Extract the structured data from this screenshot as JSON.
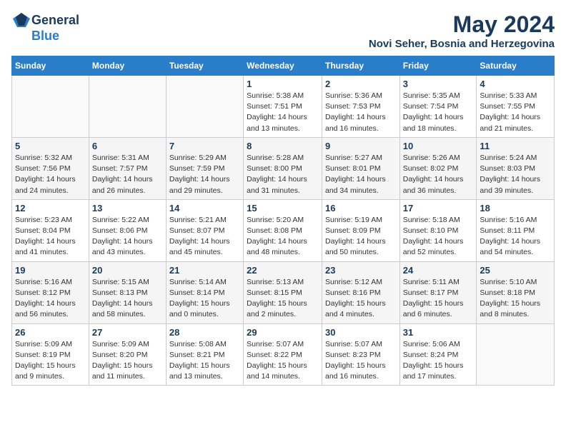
{
  "header": {
    "logo_general": "General",
    "logo_blue": "Blue",
    "month_title": "May 2024",
    "location": "Novi Seher, Bosnia and Herzegovina"
  },
  "weekdays": [
    "Sunday",
    "Monday",
    "Tuesday",
    "Wednesday",
    "Thursday",
    "Friday",
    "Saturday"
  ],
  "weeks": [
    [
      {
        "day": "",
        "info": ""
      },
      {
        "day": "",
        "info": ""
      },
      {
        "day": "",
        "info": ""
      },
      {
        "day": "1",
        "info": "Sunrise: 5:38 AM\nSunset: 7:51 PM\nDaylight: 14 hours\nand 13 minutes."
      },
      {
        "day": "2",
        "info": "Sunrise: 5:36 AM\nSunset: 7:53 PM\nDaylight: 14 hours\nand 16 minutes."
      },
      {
        "day": "3",
        "info": "Sunrise: 5:35 AM\nSunset: 7:54 PM\nDaylight: 14 hours\nand 18 minutes."
      },
      {
        "day": "4",
        "info": "Sunrise: 5:33 AM\nSunset: 7:55 PM\nDaylight: 14 hours\nand 21 minutes."
      }
    ],
    [
      {
        "day": "5",
        "info": "Sunrise: 5:32 AM\nSunset: 7:56 PM\nDaylight: 14 hours\nand 24 minutes."
      },
      {
        "day": "6",
        "info": "Sunrise: 5:31 AM\nSunset: 7:57 PM\nDaylight: 14 hours\nand 26 minutes."
      },
      {
        "day": "7",
        "info": "Sunrise: 5:29 AM\nSunset: 7:59 PM\nDaylight: 14 hours\nand 29 minutes."
      },
      {
        "day": "8",
        "info": "Sunrise: 5:28 AM\nSunset: 8:00 PM\nDaylight: 14 hours\nand 31 minutes."
      },
      {
        "day": "9",
        "info": "Sunrise: 5:27 AM\nSunset: 8:01 PM\nDaylight: 14 hours\nand 34 minutes."
      },
      {
        "day": "10",
        "info": "Sunrise: 5:26 AM\nSunset: 8:02 PM\nDaylight: 14 hours\nand 36 minutes."
      },
      {
        "day": "11",
        "info": "Sunrise: 5:24 AM\nSunset: 8:03 PM\nDaylight: 14 hours\nand 39 minutes."
      }
    ],
    [
      {
        "day": "12",
        "info": "Sunrise: 5:23 AM\nSunset: 8:04 PM\nDaylight: 14 hours\nand 41 minutes."
      },
      {
        "day": "13",
        "info": "Sunrise: 5:22 AM\nSunset: 8:06 PM\nDaylight: 14 hours\nand 43 minutes."
      },
      {
        "day": "14",
        "info": "Sunrise: 5:21 AM\nSunset: 8:07 PM\nDaylight: 14 hours\nand 45 minutes."
      },
      {
        "day": "15",
        "info": "Sunrise: 5:20 AM\nSunset: 8:08 PM\nDaylight: 14 hours\nand 48 minutes."
      },
      {
        "day": "16",
        "info": "Sunrise: 5:19 AM\nSunset: 8:09 PM\nDaylight: 14 hours\nand 50 minutes."
      },
      {
        "day": "17",
        "info": "Sunrise: 5:18 AM\nSunset: 8:10 PM\nDaylight: 14 hours\nand 52 minutes."
      },
      {
        "day": "18",
        "info": "Sunrise: 5:16 AM\nSunset: 8:11 PM\nDaylight: 14 hours\nand 54 minutes."
      }
    ],
    [
      {
        "day": "19",
        "info": "Sunrise: 5:16 AM\nSunset: 8:12 PM\nDaylight: 14 hours\nand 56 minutes."
      },
      {
        "day": "20",
        "info": "Sunrise: 5:15 AM\nSunset: 8:13 PM\nDaylight: 14 hours\nand 58 minutes."
      },
      {
        "day": "21",
        "info": "Sunrise: 5:14 AM\nSunset: 8:14 PM\nDaylight: 15 hours\nand 0 minutes."
      },
      {
        "day": "22",
        "info": "Sunrise: 5:13 AM\nSunset: 8:15 PM\nDaylight: 15 hours\nand 2 minutes."
      },
      {
        "day": "23",
        "info": "Sunrise: 5:12 AM\nSunset: 8:16 PM\nDaylight: 15 hours\nand 4 minutes."
      },
      {
        "day": "24",
        "info": "Sunrise: 5:11 AM\nSunset: 8:17 PM\nDaylight: 15 hours\nand 6 minutes."
      },
      {
        "day": "25",
        "info": "Sunrise: 5:10 AM\nSunset: 8:18 PM\nDaylight: 15 hours\nand 8 minutes."
      }
    ],
    [
      {
        "day": "26",
        "info": "Sunrise: 5:09 AM\nSunset: 8:19 PM\nDaylight: 15 hours\nand 9 minutes."
      },
      {
        "day": "27",
        "info": "Sunrise: 5:09 AM\nSunset: 8:20 PM\nDaylight: 15 hours\nand 11 minutes."
      },
      {
        "day": "28",
        "info": "Sunrise: 5:08 AM\nSunset: 8:21 PM\nDaylight: 15 hours\nand 13 minutes."
      },
      {
        "day": "29",
        "info": "Sunrise: 5:07 AM\nSunset: 8:22 PM\nDaylight: 15 hours\nand 14 minutes."
      },
      {
        "day": "30",
        "info": "Sunrise: 5:07 AM\nSunset: 8:23 PM\nDaylight: 15 hours\nand 16 minutes."
      },
      {
        "day": "31",
        "info": "Sunrise: 5:06 AM\nSunset: 8:24 PM\nDaylight: 15 hours\nand 17 minutes."
      },
      {
        "day": "",
        "info": ""
      }
    ]
  ]
}
